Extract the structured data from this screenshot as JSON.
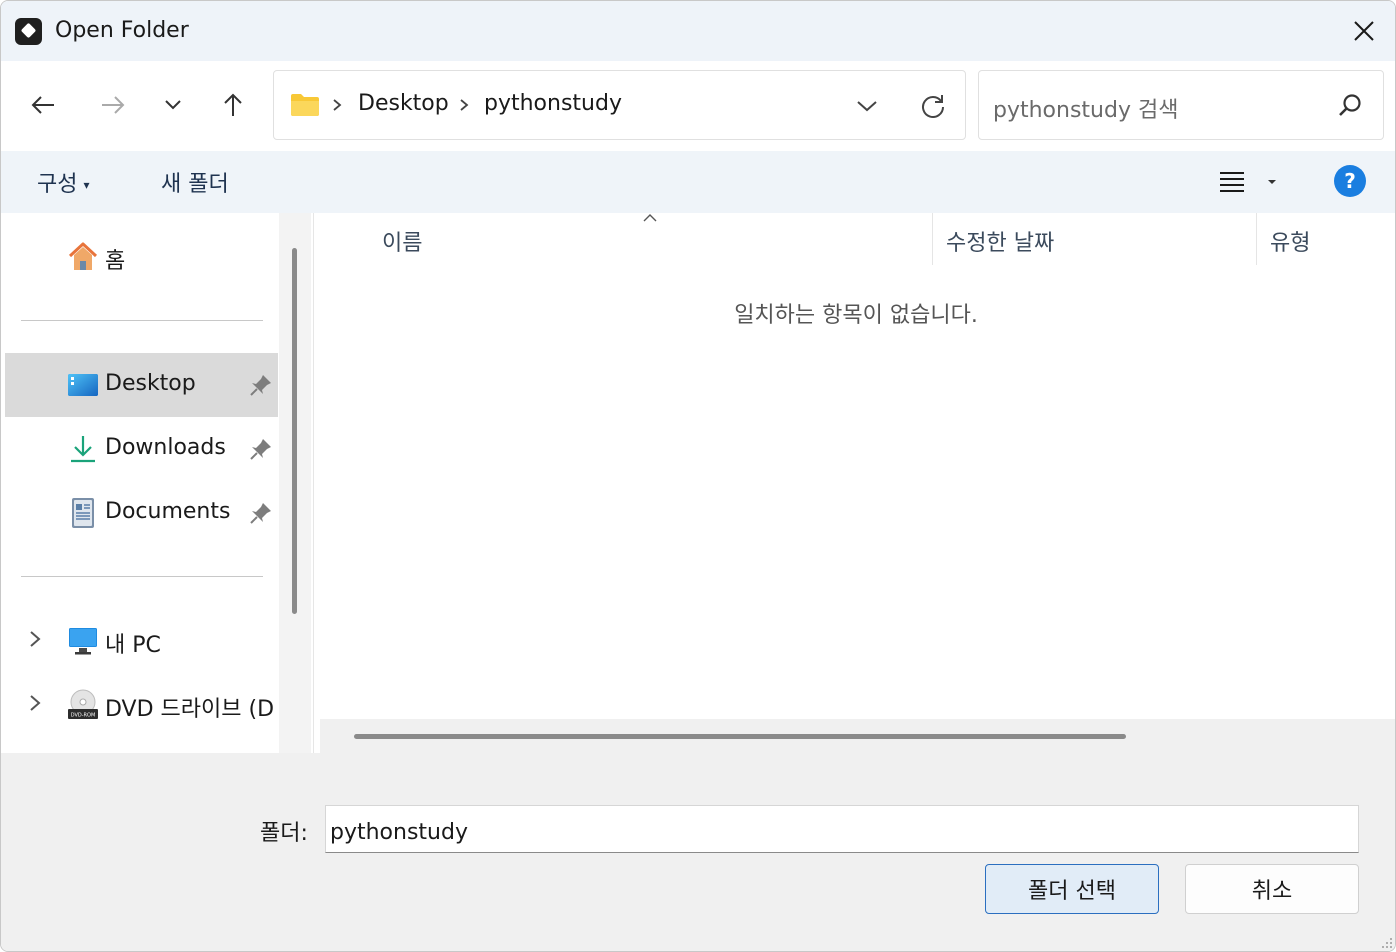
{
  "window": {
    "title": "Open Folder"
  },
  "nav": {
    "back_icon": "arrow-left-icon",
    "forward_icon": "arrow-right-icon",
    "recent_icon": "chevron-down-icon",
    "up_icon": "arrow-up-icon"
  },
  "address": {
    "crumbs": [
      "Desktop",
      "pythonstudy"
    ]
  },
  "search": {
    "placeholder": "pythonstudy 검색"
  },
  "command_bar": {
    "organize": "구성",
    "new_folder": "새 폴더",
    "help": "?"
  },
  "sidebar": {
    "items": [
      {
        "label": "홈",
        "icon": "home-icon"
      },
      {
        "label": "Desktop",
        "icon": "desktop-icon",
        "pinned": true,
        "selected": true
      },
      {
        "label": "Downloads",
        "icon": "download-icon",
        "pinned": true
      },
      {
        "label": "Documents",
        "icon": "documents-icon",
        "pinned": true
      },
      {
        "label": "내 PC",
        "icon": "monitor-icon"
      },
      {
        "label": "DVD 드라이브 (D",
        "icon": "dvd-drive-icon"
      }
    ]
  },
  "content": {
    "columns": [
      "이름",
      "수정한 날짜",
      "유형"
    ],
    "empty_message": "일치하는 항목이 없습니다."
  },
  "footer": {
    "folder_label": "폴더:",
    "folder_value": "pythonstudy",
    "select_button": "폴더 선택",
    "cancel_button": "취소"
  },
  "colors": {
    "accent": "#1a7ee0",
    "titlebar_bg": "#eef3f9",
    "selected_bg": "#dadada",
    "primary_button_bg": "#e1ecf7",
    "primary_button_border": "#2b6fc0"
  }
}
